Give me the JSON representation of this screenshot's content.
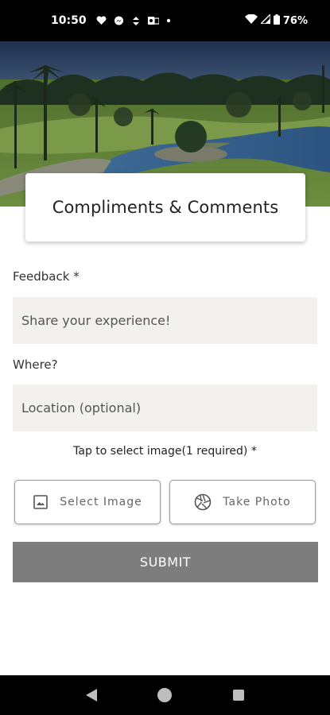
{
  "status_bar": {
    "time": "10:50",
    "battery": "76%",
    "icons": [
      "heart-icon",
      "messenger-icon",
      "sync-icon",
      "outlook-icon",
      "dot-icon",
      "wifi-icon",
      "signal-icon",
      "battery-icon"
    ]
  },
  "hero": {
    "image": "golf-course-photo"
  },
  "page": {
    "title": "Compliments & Comments"
  },
  "form": {
    "feedback_label": "Feedback *",
    "feedback_placeholder": "Share your experience!",
    "where_label": "Where?",
    "location_placeholder": "Location (optional)",
    "image_note": "Tap to select image(1 required) *",
    "select_image_label": "Select Image",
    "take_photo_label": "Take Photo",
    "submit_label": "SUBMIT"
  },
  "nav": {
    "icons": [
      "back-icon",
      "home-icon",
      "recents-icon"
    ]
  },
  "colors": {
    "input_bg": "#f3f1ee",
    "submit_bg": "#7d7d7d",
    "bar_bg": "#000000"
  }
}
